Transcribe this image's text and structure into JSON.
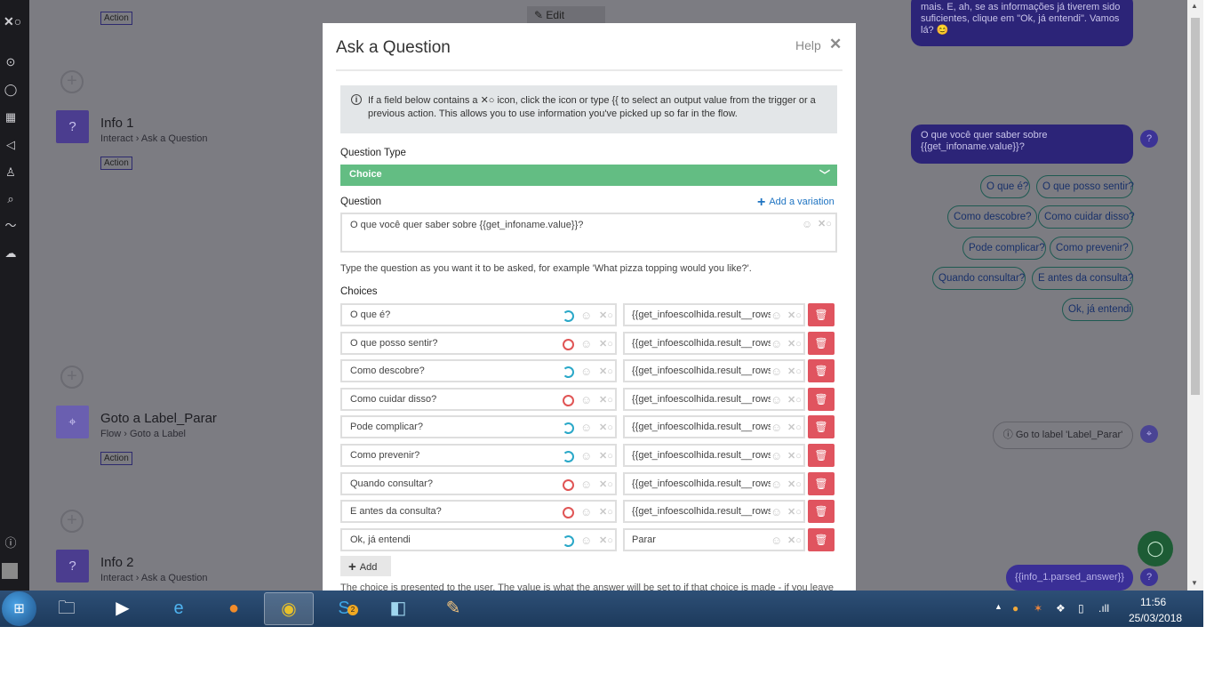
{
  "background_flow": {
    "top_edit_label": "Edit",
    "top_action_tag": "Action",
    "steps": [
      {
        "title": "Info 1",
        "subtitle": "Interact › Ask a Question",
        "tag": "Action"
      },
      {
        "title": "Goto a Label_Parar",
        "subtitle": "Flow › Goto a Label",
        "tag": "Action"
      },
      {
        "title": "Info 2",
        "subtitle": "Interact › Ask a Question"
      }
    ]
  },
  "preview": {
    "top_bubble": "mais. E, ah, se as informações já tiverem sido suficientes, clique em \"Ok, já entendi\". Vamos lá? 😊",
    "question_bubble": "O que você quer saber sobre {{get_infoname.value}}?",
    "choice_pills": [
      "O que é?",
      "O que posso sentir?",
      "Como descobre?",
      "Como cuidar disso?",
      "Pode complicar?",
      "Como prevenir?",
      "Quando consultar?",
      "E antes da consulta?",
      "Ok, já entendi"
    ],
    "goto_pill": "Go to label 'Label_Parar'",
    "answer_pill": "{{info_1.parsed_answer}}"
  },
  "modal": {
    "title": "Ask a Question",
    "help_label": "Help",
    "info_text": "If a field below contains a ✕○ icon, click the icon or type {{ to select an output value from the trigger or a previous action. This allows you to use information you've picked up so far in the flow.",
    "question_type_label": "Question Type",
    "question_type_value": "Choice",
    "question_label": "Question",
    "add_variation_label": "Add a variation",
    "question_value": "O que você quer saber sobre {{get_infoname.value}}?",
    "question_hint": "Type the question as you want it to be asked, for example 'What pizza topping would you like?'.",
    "choices_label": "Choices",
    "choices": [
      {
        "text": "O que é?",
        "value": "{{get_infoescolhida.result__rows",
        "status": "spin"
      },
      {
        "text": "O que posso sentir?",
        "value": "{{get_infoescolhida.result__rows",
        "status": "red"
      },
      {
        "text": "Como descobre?",
        "value": "{{get_infoescolhida.result__rows",
        "status": "spin"
      },
      {
        "text": "Como cuidar disso?",
        "value": "{{get_infoescolhida.result__rows",
        "status": "red"
      },
      {
        "text": "Pode complicar?",
        "value": "{{get_infoescolhida.result__rows",
        "status": "spin"
      },
      {
        "text": "Como prevenir?",
        "value": "{{get_infoescolhida.result__rows",
        "status": "spin"
      },
      {
        "text": "Quando consultar?",
        "value": "{{get_infoescolhida.result__rows",
        "status": "red"
      },
      {
        "text": "E antes da consulta?",
        "value": "{{get_infoescolhida.result__rows",
        "status": "red"
      },
      {
        "text": "Ok, já entendi",
        "value": "Parar",
        "status": "spin"
      }
    ],
    "add_choice_label": "Add",
    "choice_footnote": "The choice is presented to the user. The value is what the answer will be set to if that choice is made - if you leave"
  },
  "taskbar": {
    "clock_time": "11:56",
    "clock_date": "25/03/2018",
    "skype_badge": "2"
  },
  "colors": {
    "accent_green": "#63bd83",
    "delete_red": "#e0545f",
    "link_blue": "#1f74c2",
    "brand_purple": "#4b3d8f"
  }
}
